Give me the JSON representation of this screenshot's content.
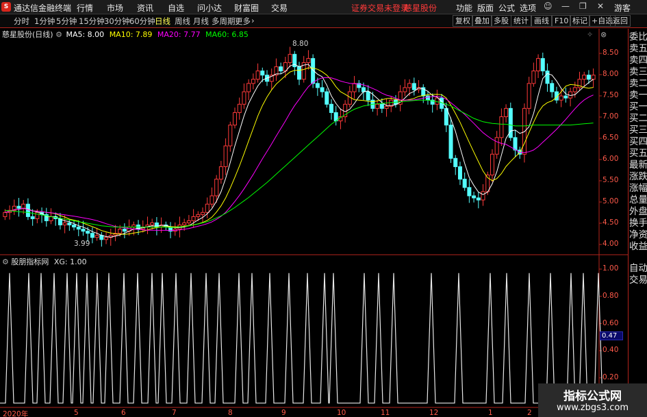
{
  "app": {
    "logo": "S",
    "name": "通达信金融终端"
  },
  "menu": [
    "行情",
    "市场",
    "资讯",
    "自选",
    "问小达",
    "财富圈",
    "交易"
  ],
  "notice": "证券交易未登录",
  "stock_name": "慈星股份",
  "right_menu": [
    "功能",
    "版面",
    "公式",
    "选项"
  ],
  "user": "游客",
  "period_tabs": [
    "分时",
    "1分钟",
    "5分钟",
    "15分钟",
    "30分钟",
    "60分钟",
    "日线",
    "周线",
    "月线",
    "多周期",
    "更多"
  ],
  "active_tab": "日线",
  "right_buttons": [
    "复权",
    "叠加",
    "多股",
    "统计",
    "画线",
    "F10",
    "标记",
    "+自选",
    "返回"
  ],
  "main_legend": {
    "title": "慈星股份(日线)",
    "ma5": "MA5: 8.00",
    "ma10": "MA10: 7.89",
    "ma20": "MA20: 7.77",
    "ma60": "MA60: 6.85",
    "colors": {
      "ma5": "#ffffff",
      "ma10": "#ffff00",
      "ma20": "#ff00ff",
      "ma60": "#00ff00",
      "up": "#ff3a3a",
      "down": "#54ffff"
    }
  },
  "sub_legend": {
    "title": "股朋指标网",
    "xg": "XG: 1.00"
  },
  "price_axis": [
    "8.50",
    "8.00",
    "7.50",
    "7.00",
    "6.50",
    "6.00",
    "5.50",
    "5.00",
    "4.50",
    "4.00"
  ],
  "ind_axis": [
    "1.00",
    "0.80",
    "0.60",
    "0.40",
    "0.20"
  ],
  "current_value": "0.47",
  "high_label": "8.80",
  "low_label": "3.99",
  "x_axis": [
    "2020年",
    "5",
    "6",
    "7",
    "8",
    "9",
    "10",
    "11",
    "12",
    "1",
    "2"
  ],
  "side_panel": [
    "委比",
    "卖五",
    "卖四",
    "卖三",
    "卖二",
    "卖一",
    "买一",
    "买二",
    "买三",
    "买四",
    "买五",
    "最新",
    "涨跌",
    "涨幅",
    "总量",
    "外盘",
    "换手",
    "净资",
    "收益"
  ],
  "side_panel2": [
    "自动",
    "交易"
  ],
  "watermark": {
    "line1": "指标公式网",
    "line2": "www.zbgs3.com"
  },
  "chart_data": {
    "type": "candlestick",
    "price_ylim": [
      3.8,
      8.9
    ],
    "closes": [
      4.7,
      4.75,
      4.85,
      4.8,
      4.9,
      4.6,
      4.55,
      4.7,
      4.65,
      4.5,
      4.6,
      4.55,
      4.4,
      4.45,
      4.4,
      4.35,
      4.3,
      4.25,
      4.2,
      4.1,
      4.15,
      4.05,
      4.1,
      4.15,
      4.2,
      4.3,
      4.25,
      4.35,
      4.4,
      4.3,
      4.35,
      4.4,
      4.45,
      4.35,
      4.4,
      4.35,
      4.25,
      4.3,
      4.4,
      4.45,
      4.5,
      4.6,
      4.65,
      4.7,
      4.9,
      5.1,
      5.5,
      5.8,
      6.3,
      6.8,
      7.1,
      7.3,
      7.6,
      7.8,
      7.9,
      8.1,
      8.0,
      7.85,
      8.0,
      8.2,
      8.1,
      8.3,
      8.5,
      8.2,
      7.9,
      8.3,
      8.4,
      7.8,
      7.7,
      7.6,
      7.3,
      7.1,
      6.9,
      7.0,
      7.3,
      7.6,
      7.8,
      7.7,
      7.6,
      7.4,
      7.2,
      7.3,
      7.2,
      7.25,
      7.4,
      7.3,
      7.6,
      7.7,
      7.8,
      7.65,
      7.7,
      7.5,
      7.4,
      7.3,
      7.45,
      7.2,
      6.8,
      6.0,
      5.8,
      5.5,
      5.3,
      5.1,
      5.05,
      5.0,
      5.2,
      5.6,
      6.1,
      6.5,
      7.0,
      7.2,
      6.5,
      6.2,
      6.1,
      7.2,
      7.8,
      8.1,
      8.4,
      8.1,
      7.8,
      7.6,
      7.4,
      7.5,
      7.45,
      7.6,
      7.7,
      7.9,
      8.0,
      7.9,
      8.0
    ],
    "opens": [
      4.6,
      4.7,
      4.75,
      4.85,
      4.8,
      4.9,
      4.6,
      4.55,
      4.7,
      4.65,
      4.5,
      4.6,
      4.55,
      4.4,
      4.45,
      4.4,
      4.35,
      4.3,
      4.25,
      4.2,
      4.1,
      4.15,
      4.05,
      4.1,
      4.15,
      4.2,
      4.3,
      4.25,
      4.35,
      4.4,
      4.3,
      4.35,
      4.4,
      4.45,
      4.35,
      4.4,
      4.35,
      4.25,
      4.3,
      4.4,
      4.45,
      4.5,
      4.6,
      4.65,
      4.7,
      4.9,
      5.1,
      5.5,
      5.8,
      6.3,
      6.8,
      7.1,
      7.3,
      7.6,
      7.8,
      7.9,
      8.1,
      8.0,
      7.85,
      8.0,
      8.2,
      8.1,
      8.3,
      8.5,
      8.2,
      7.9,
      8.3,
      8.4,
      7.8,
      7.7,
      7.6,
      7.3,
      7.1,
      6.9,
      7.0,
      7.3,
      7.6,
      7.8,
      7.7,
      7.6,
      7.4,
      7.2,
      7.3,
      7.2,
      7.25,
      7.4,
      7.3,
      7.6,
      7.7,
      7.8,
      7.65,
      7.7,
      7.5,
      7.4,
      7.3,
      7.45,
      7.2,
      6.8,
      6.0,
      5.8,
      5.5,
      5.3,
      5.1,
      5.05,
      5.0,
      5.2,
      5.6,
      6.1,
      6.5,
      7.0,
      7.2,
      6.5,
      6.2,
      6.1,
      7.2,
      7.8,
      8.1,
      8.4,
      8.1,
      7.8,
      7.6,
      7.4,
      7.5,
      7.45,
      7.6,
      7.7,
      7.9,
      8.0,
      7.9
    ],
    "ma60": [
      4.75,
      4.74,
      4.73,
      4.72,
      4.71,
      4.7,
      4.68,
      4.66,
      4.64,
      4.62,
      4.6,
      4.58,
      4.56,
      4.54,
      4.52,
      4.5,
      4.48,
      4.46,
      4.44,
      4.42,
      4.4,
      4.38,
      4.37,
      4.36,
      4.35,
      4.35,
      4.35,
      4.35,
      4.35,
      4.35,
      4.35,
      4.35,
      4.35,
      4.35,
      4.35,
      4.35,
      4.34,
      4.34,
      4.35,
      4.36,
      4.38,
      4.4,
      4.42,
      4.45,
      4.48,
      4.52,
      4.57,
      4.62,
      4.68,
      4.75,
      4.82,
      4.9,
      4.98,
      5.06,
      5.15,
      5.24,
      5.33,
      5.42,
      5.52,
      5.62,
      5.72,
      5.82,
      5.92,
      6.02,
      6.12,
      6.22,
      6.32,
      6.42,
      6.52,
      6.62,
      6.72,
      6.82,
      6.9,
      6.98,
      7.05,
      7.12,
      7.18,
      7.22,
      7.26,
      7.28,
      7.3,
      7.31,
      7.32,
      7.33,
      7.34,
      7.35,
      7.36,
      7.37,
      7.38,
      7.39,
      7.4,
      7.4,
      7.4,
      7.38,
      7.36,
      7.34,
      7.3,
      7.26,
      7.2,
      7.14,
      7.08,
      7.02,
      6.96,
      6.92,
      6.88,
      6.86,
      6.84,
      6.83,
      6.82,
      6.82,
      6.8,
      6.78,
      6.78,
      6.78,
      6.79,
      6.8,
      6.8,
      6.8,
      6.8,
      6.8,
      6.8,
      6.8,
      6.8,
      6.8,
      6.81,
      6.82,
      6.83,
      6.84,
      6.85
    ],
    "ind_ylim": [
      0.1,
      1.05
    ],
    "signal_positions": [
      14,
      42,
      60,
      79,
      98,
      112,
      127,
      142,
      159,
      181,
      201,
      222,
      237,
      257,
      279,
      301,
      320,
      349,
      368,
      394,
      422,
      449,
      474,
      487,
      532,
      553,
      575,
      630,
      670,
      716,
      740,
      773,
      804,
      834,
      852,
      874
    ]
  }
}
